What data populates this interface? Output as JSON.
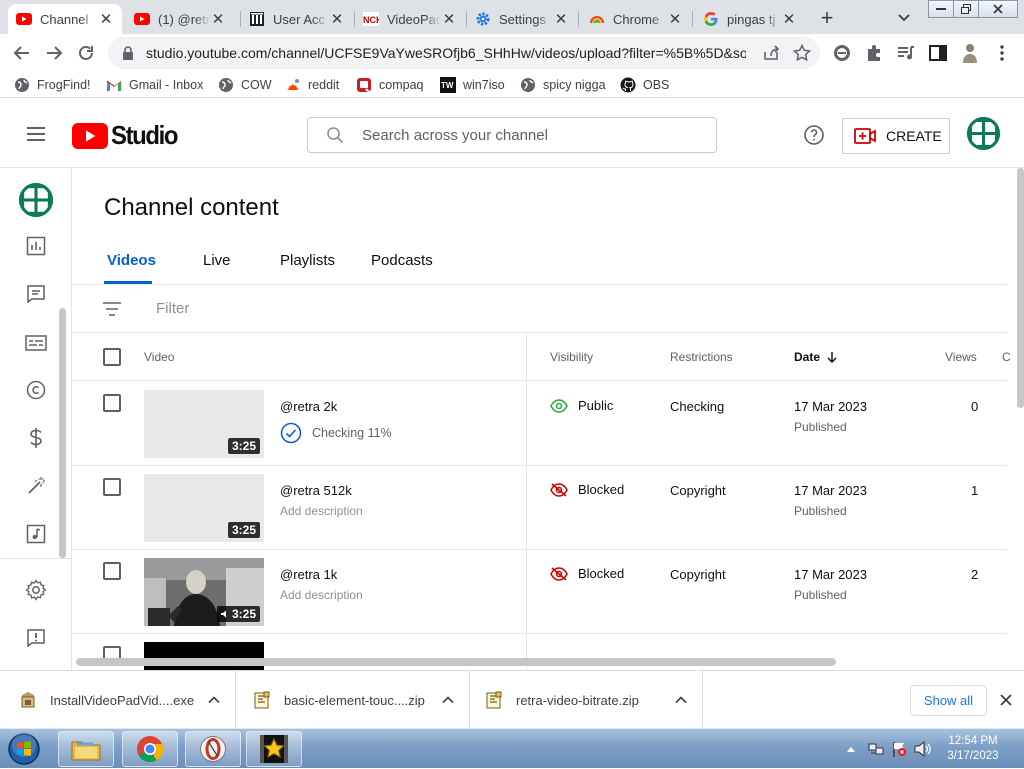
{
  "browser": {
    "tabs": [
      {
        "title": "Channel",
        "favicon": "youtube-studio",
        "active": true
      },
      {
        "title": "(1) @retr",
        "favicon": "youtube",
        "active": false
      },
      {
        "title": "User Acc",
        "favicon": "library",
        "active": false
      },
      {
        "title": "VideoPad",
        "favicon": "nch",
        "active": false
      },
      {
        "title": "Settings",
        "favicon": "gear",
        "active": false
      },
      {
        "title": "Chrome",
        "favicon": "chrome",
        "active": false
      },
      {
        "title": "pingas tj",
        "favicon": "google",
        "active": false
      }
    ],
    "url": "studio.youtube.com/channel/UCFSE9VaYweSROfjb6_SHhHw/videos/upload?filter=%5B%5D&sort...",
    "bookmarks": [
      {
        "label": "FrogFind!",
        "icon": "globe"
      },
      {
        "label": "Gmail - Inbox",
        "icon": "gmail"
      },
      {
        "label": "COW",
        "icon": "globe"
      },
      {
        "label": "reddit",
        "icon": "reddit"
      },
      {
        "label": "compaq",
        "icon": "compaq"
      },
      {
        "label": "win7iso",
        "icon": "tw"
      },
      {
        "label": "spicy nigga",
        "icon": "globe"
      },
      {
        "label": "OBS",
        "icon": "github"
      }
    ]
  },
  "studio": {
    "logo_text": "Studio",
    "search_placeholder": "Search across your channel",
    "create_label": "CREATE",
    "page_title": "Channel content",
    "tabs": [
      "Videos",
      "Live",
      "Playlists",
      "Podcasts"
    ],
    "active_tab": "Videos",
    "filter_placeholder": "Filter",
    "columns": {
      "video": "Video",
      "visibility": "Visibility",
      "restrictions": "Restrictions",
      "date": "Date",
      "views": "Views",
      "comments": "C"
    },
    "videos": [
      {
        "title": "@retra 2k",
        "subtitle": "Checking 11%",
        "duration": "3:25",
        "visibility": "Public",
        "restrictions": "Checking",
        "date": "17 Mar 2023",
        "date_status": "Published",
        "views": "0"
      },
      {
        "title": "@retra 512k",
        "subtitle": "Add description",
        "duration": "3:25",
        "visibility": "Blocked",
        "restrictions": "Copyright",
        "date": "17 Mar 2023",
        "date_status": "Published",
        "views": "1"
      },
      {
        "title": "@retra 1k",
        "subtitle": "Add description",
        "duration": "3:25",
        "visibility": "Blocked",
        "restrictions": "Copyright",
        "date": "17 Mar 2023",
        "date_status": "Published",
        "views": "2"
      }
    ]
  },
  "downloads": {
    "items": [
      "InstallVideoPadVid....exe",
      "basic-element-touc....zip",
      "retra-video-bitrate.zip"
    ],
    "show_all": "Show all"
  },
  "taskbar": {
    "time": "12:54 PM",
    "date": "3/17/2023"
  },
  "colors": {
    "accent_blue": "#065fd4",
    "youtube_red": "#ff0000",
    "visibility_public": "#2ba640",
    "visibility_blocked": "#cc0000"
  }
}
